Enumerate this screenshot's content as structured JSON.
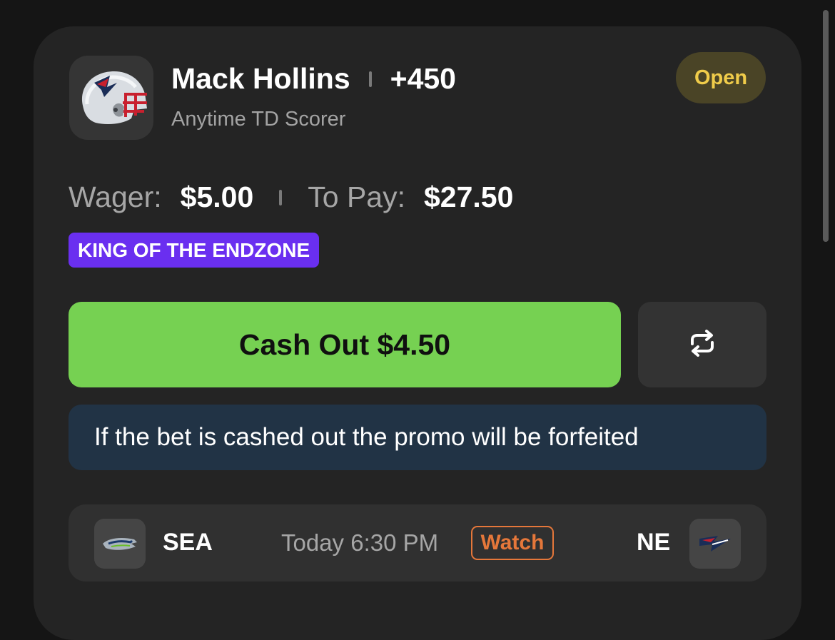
{
  "bet": {
    "player_name": "Mack Hollins",
    "odds": "+450",
    "market": "Anytime TD Scorer",
    "status": "Open",
    "wager_label": "Wager:",
    "wager_value": "$5.00",
    "to_pay_label": "To Pay:",
    "to_pay_value": "$27.50",
    "promo_badge": "KING OF THE ENDZONE",
    "cashout_label": "Cash Out $4.50",
    "notice": "If the bet is cashed out the promo will be forfeited"
  },
  "game": {
    "away_team": "SEA",
    "home_team": "NE",
    "time": "Today 6:30 PM",
    "watch_label": "Watch"
  },
  "icons": {
    "player_icon": "patriots-helmet-icon",
    "refresh_icon": "repeat-arrows-icon",
    "away_logo": "seahawks-logo-icon",
    "home_logo": "patriots-logo-icon"
  },
  "colors": {
    "background": "#151515",
    "card": "#242424",
    "status_pill_bg": "#4a4426",
    "status_pill_text": "#f0cc4a",
    "promo_badge": "#6a2ff0",
    "cashout_button": "#76d152",
    "notice_bg": "#213345",
    "watch_accent": "#e5773a"
  }
}
